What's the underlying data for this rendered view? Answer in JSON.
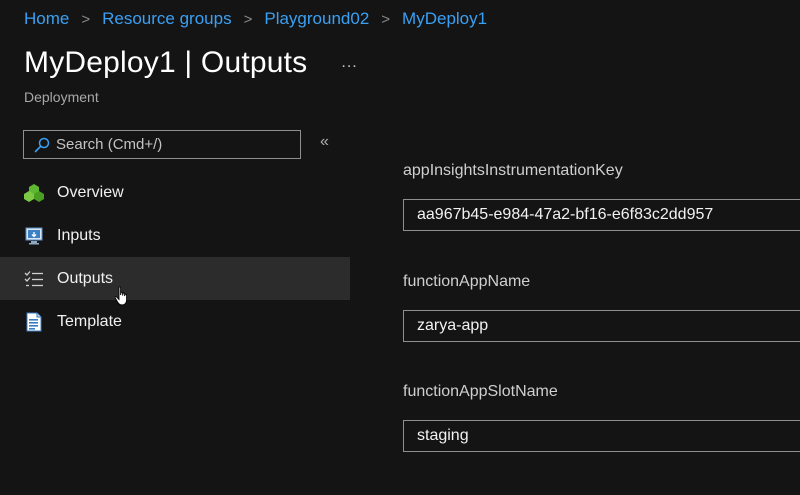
{
  "breadcrumb": {
    "items": [
      "Home",
      "Resource groups",
      "Playground02",
      "MyDeploy1"
    ],
    "separator": ">"
  },
  "header": {
    "title": "MyDeploy1 | Outputs",
    "more": "...",
    "subtitle": "Deployment"
  },
  "sidebar": {
    "search_placeholder": "Search (Cmd+/)",
    "collapse": "«",
    "items": [
      {
        "label": "Overview",
        "icon": "overview-icon"
      },
      {
        "label": "Inputs",
        "icon": "inputs-icon"
      },
      {
        "label": "Outputs",
        "icon": "outputs-icon",
        "active": true
      },
      {
        "label": "Template",
        "icon": "template-icon"
      }
    ]
  },
  "outputs": [
    {
      "label": "appInsightsInstrumentationKey",
      "value": "aa967b45-e984-47a2-bf16-e6f83c2dd957"
    },
    {
      "label": "functionAppName",
      "value": "zarya-app"
    },
    {
      "label": "functionAppSlotName",
      "value": "staging"
    }
  ],
  "colors": {
    "background": "#141414",
    "link": "#3aa0f3",
    "active_row": "#2c2c2c"
  }
}
